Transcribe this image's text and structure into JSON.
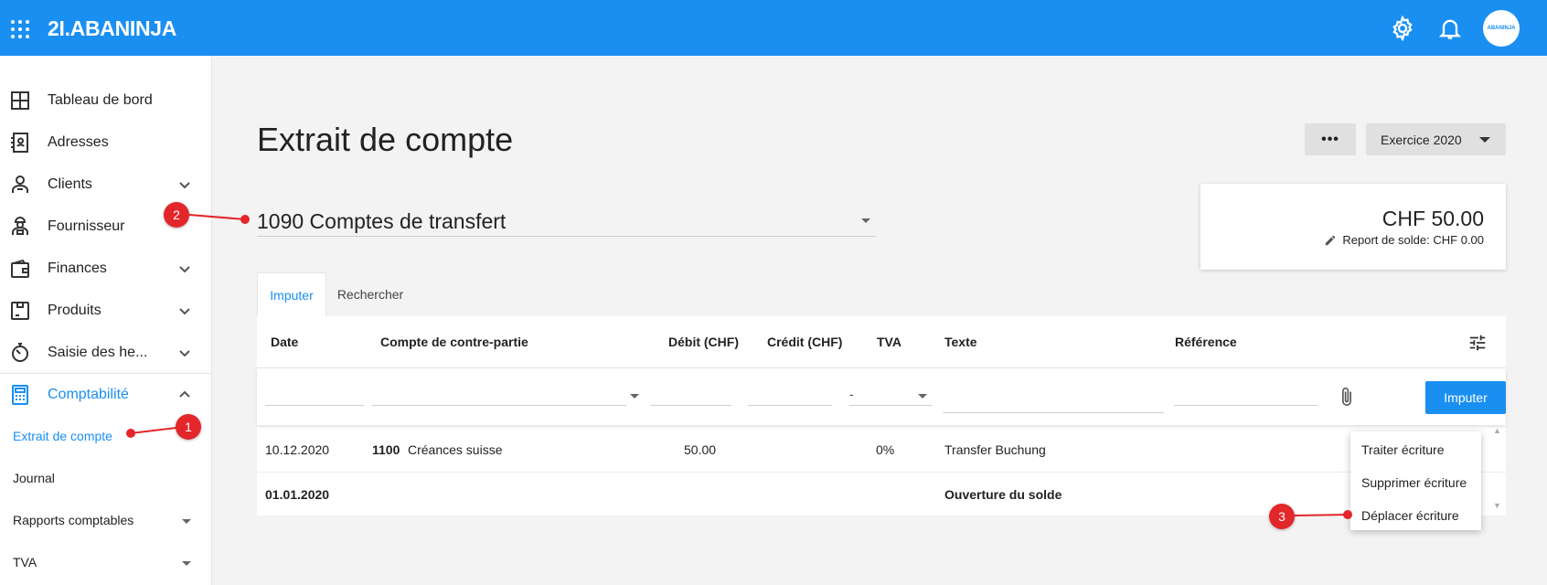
{
  "app": {
    "logo": "2I.ABANINJA",
    "avatar_text": "ABANINJA"
  },
  "sidebar": {
    "items": [
      {
        "label": "Tableau de bord",
        "icon": "dashboard-icon"
      },
      {
        "label": "Adresses",
        "icon": "address-book-icon"
      },
      {
        "label": "Clients",
        "icon": "clients-icon"
      },
      {
        "label": "Fournisseur",
        "icon": "supplier-icon"
      },
      {
        "label": "Finances",
        "icon": "wallet-icon"
      },
      {
        "label": "Produits",
        "icon": "products-icon"
      },
      {
        "label": "Saisie des he...",
        "icon": "stopwatch-icon"
      },
      {
        "label": "Comptabilité",
        "icon": "calculator-icon"
      }
    ],
    "sub_items": [
      "Extrait de compte",
      "Journal",
      "Rapports comptables",
      "TVA"
    ]
  },
  "page": {
    "title": "Extrait de compte",
    "more_label": "•••",
    "year_label": "Exercice 2020",
    "account": "1090 Comptes de transfert"
  },
  "balance": {
    "amount": "CHF 50.00",
    "report": "Report de solde: CHF 0.00"
  },
  "tabs": [
    "Imputer",
    "Rechercher"
  ],
  "table": {
    "columns": [
      "Date",
      "Compte de contre-partie",
      "Débit (CHF)",
      "Crédit (CHF)",
      "TVA",
      "Texte",
      "Référence"
    ],
    "entry": {
      "tva_value": "-",
      "submit_label": "Imputer"
    },
    "rows": [
      {
        "date": "10.12.2020",
        "account_no": "1100",
        "account_name": "Créances suisse",
        "debit": "50.00",
        "credit": "",
        "tva": "0%",
        "text": "Transfer Buchung",
        "reference": ""
      },
      {
        "date": "01.01.2020",
        "text": "Ouverture du solde"
      }
    ]
  },
  "context_menu": [
    "Traiter écriture",
    "Supprimer écriture",
    "Déplacer écriture"
  ],
  "annotations": [
    "1",
    "2",
    "3"
  ],
  "colors": {
    "primary": "#1a8ff2",
    "badge": "#e3262a"
  }
}
